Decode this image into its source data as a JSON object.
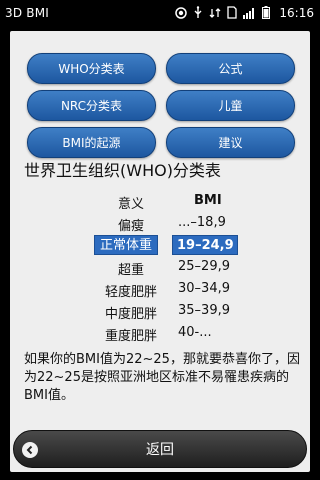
{
  "status_bar": {
    "app_title": "3D BMI",
    "time": "16:16"
  },
  "buttons": {
    "who": "WHO分类表",
    "formula": "公式",
    "nrc": "NRC分类表",
    "children": "儿童",
    "bmi_origin": "BMI的起源",
    "suggestions": "建议"
  },
  "section_title": "世界卫生组织(WHO)分类表",
  "table": {
    "header": {
      "meaning": "意义",
      "bmi": "BMI"
    },
    "rows": [
      {
        "meaning": "偏瘦",
        "range": "...–18,9",
        "highlighted": false
      },
      {
        "meaning": "正常体重",
        "range": "19–24,9",
        "highlighted": true
      },
      {
        "meaning": "超重",
        "range": "25–29,9",
        "highlighted": false
      },
      {
        "meaning": "轻度肥胖",
        "range": "30–34,9",
        "highlighted": false
      },
      {
        "meaning": "中度肥胖",
        "range": "35–39,9",
        "highlighted": false
      },
      {
        "meaning": "重度肥胖",
        "range": "40-...",
        "highlighted": false
      }
    ]
  },
  "paragraph": "如果你的BMI值为22~25，那就要恭喜你了，因为22~25是按照亚洲地区标准不易罹患疾病的BMI值。",
  "back_button": {
    "label": "返回"
  },
  "colors": {
    "accent": "#2c6bbf",
    "panel_background": "#eeeeee",
    "status_bar": "#000000"
  }
}
